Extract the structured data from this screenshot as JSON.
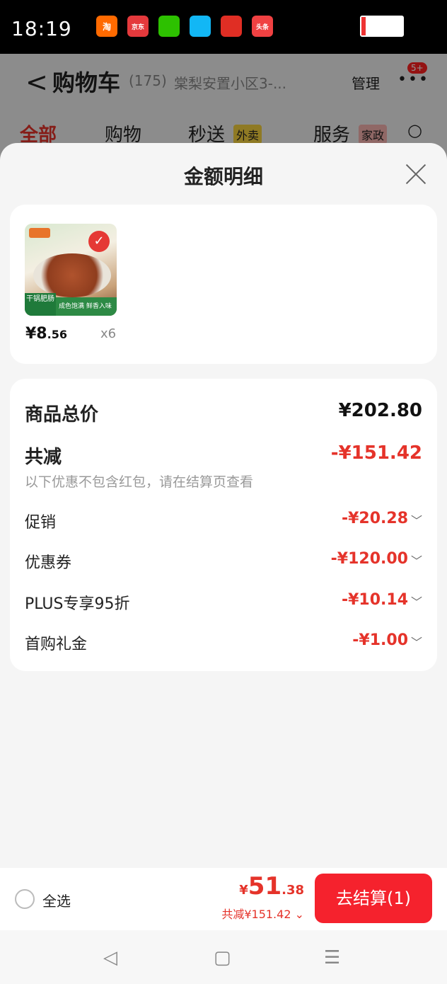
{
  "status_bar": {
    "time": "18:19",
    "apps": [
      {
        "icon": "taobao-app-icon",
        "label": "淘",
        "color": "#ff6a00"
      },
      {
        "icon": "jd-app-icon",
        "label": "京东",
        "color": "#e4393c"
      },
      {
        "icon": "wechat-app-icon",
        "label": "",
        "color": "#2dc100"
      },
      {
        "icon": "qq-app-icon",
        "label": "",
        "color": "#12b7f5"
      },
      {
        "icon": "pinduoduo-app-icon",
        "label": "",
        "color": "#e02e24"
      },
      {
        "icon": "toutiao-app-icon",
        "label": "头条",
        "color": "#f04142"
      }
    ]
  },
  "background_page": {
    "back": "<",
    "title": "购物车",
    "count": "(175)",
    "address": "棠梨安置小区3-...",
    "manage": "管理",
    "more": "•••",
    "badge": "5+",
    "tabs": [
      "全部",
      "购物",
      "秒送",
      "服务"
    ],
    "tags": [
      "外卖",
      "家政"
    ]
  },
  "sheet": {
    "title": "金额明细",
    "product": {
      "image_text_corner": "干锅肥肠",
      "image_text_bar": "成色饱满 鲜香入味",
      "price_main": "¥8",
      "price_decimal": ".56",
      "quantity": "x6"
    },
    "summary": {
      "total_label": "商品总价",
      "total_value": "¥202.80",
      "saving_label": "共减",
      "saving_value": "-¥151.42",
      "note": "以下优惠不包含红包，请在结算页查看",
      "items": [
        {
          "label": "促销",
          "value": "-¥20.28"
        },
        {
          "label": "优惠券",
          "value": "-¥120.00"
        },
        {
          "label": "PLUS专享95折",
          "value": "-¥10.14"
        },
        {
          "label": "首购礼金",
          "value": "-¥1.00"
        }
      ]
    }
  },
  "bottom_bar": {
    "select_all": "全选",
    "price_yen": "¥",
    "price_int": "51",
    "price_dec": ".38",
    "saving": "共减¥151.42 ⌄",
    "checkout": "去结算(1)"
  },
  "nav": {
    "back": "◁",
    "home": "▢",
    "menu": "☰"
  }
}
